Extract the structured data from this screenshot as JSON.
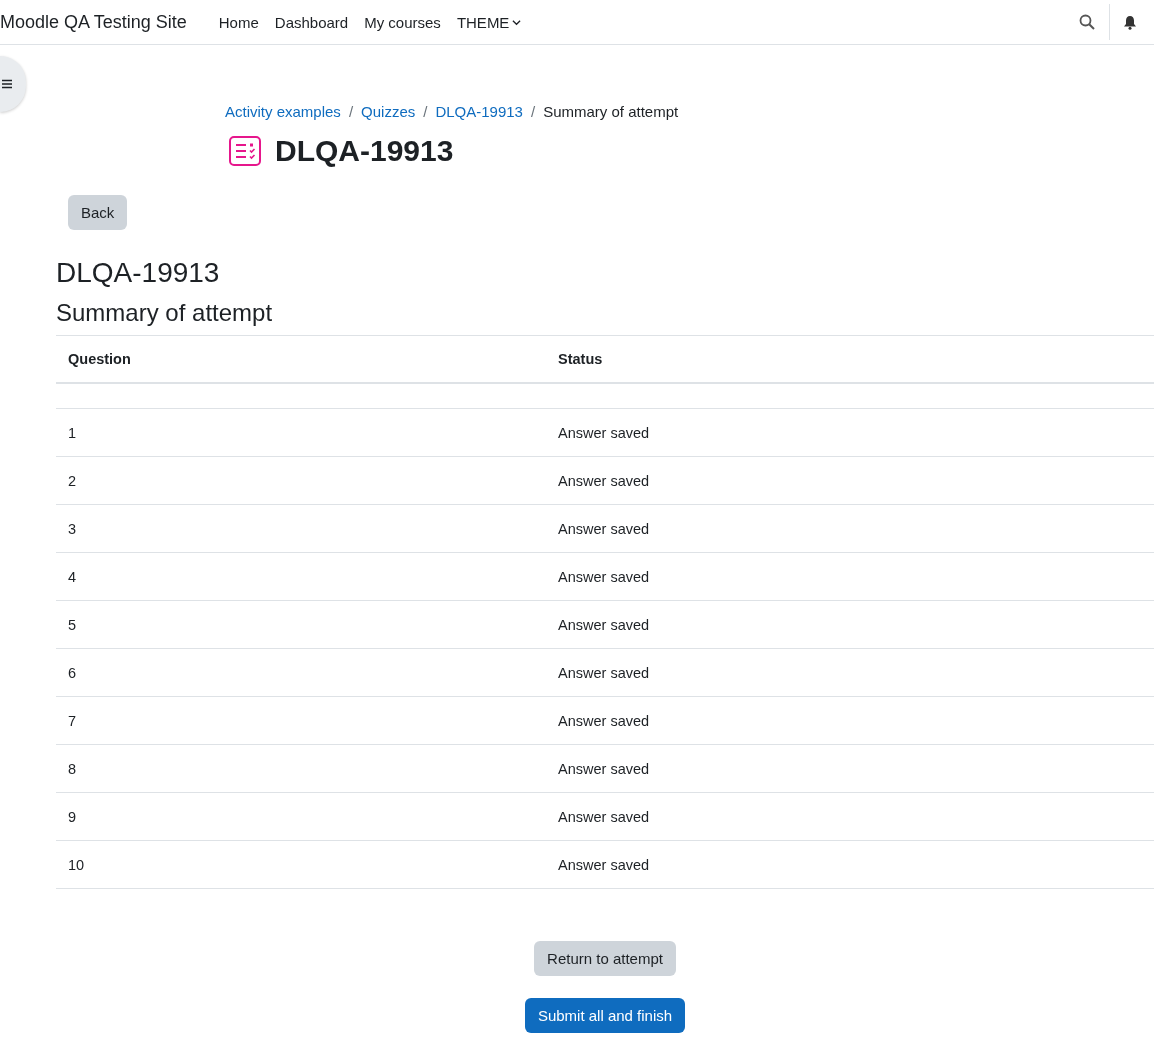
{
  "navbar": {
    "site_name": "Moodle QA Testing Site",
    "links": [
      {
        "label": "Home",
        "kind": "link"
      },
      {
        "label": "Dashboard",
        "kind": "link"
      },
      {
        "label": "My courses",
        "kind": "link"
      },
      {
        "label": "THEME",
        "kind": "dropdown"
      }
    ]
  },
  "breadcrumb": [
    {
      "label": "Activity examples",
      "kind": "link"
    },
    {
      "label": "Quizzes",
      "kind": "link"
    },
    {
      "label": "DLQA-19913",
      "kind": "link"
    },
    {
      "label": "Summary of attempt",
      "kind": "current"
    }
  ],
  "breadcrumb_separator": "/",
  "page_title": "DLQA-19913",
  "back_button": "Back",
  "quiz_title": "DLQA-19913",
  "section_title": "Summary of attempt",
  "table": {
    "columns": [
      "Question",
      "Status"
    ],
    "rows": [
      {
        "question": "1",
        "status": "Answer saved"
      },
      {
        "question": "2",
        "status": "Answer saved"
      },
      {
        "question": "3",
        "status": "Answer saved"
      },
      {
        "question": "4",
        "status": "Answer saved"
      },
      {
        "question": "5",
        "status": "Answer saved"
      },
      {
        "question": "6",
        "status": "Answer saved"
      },
      {
        "question": "7",
        "status": "Answer saved"
      },
      {
        "question": "8",
        "status": "Answer saved"
      },
      {
        "question": "9",
        "status": "Answer saved"
      },
      {
        "question": "10",
        "status": "Answer saved"
      }
    ]
  },
  "buttons": [
    {
      "label": "Return to attempt",
      "kind": "secondary"
    },
    {
      "label": "Submit all and finish",
      "kind": "primary"
    }
  ]
}
